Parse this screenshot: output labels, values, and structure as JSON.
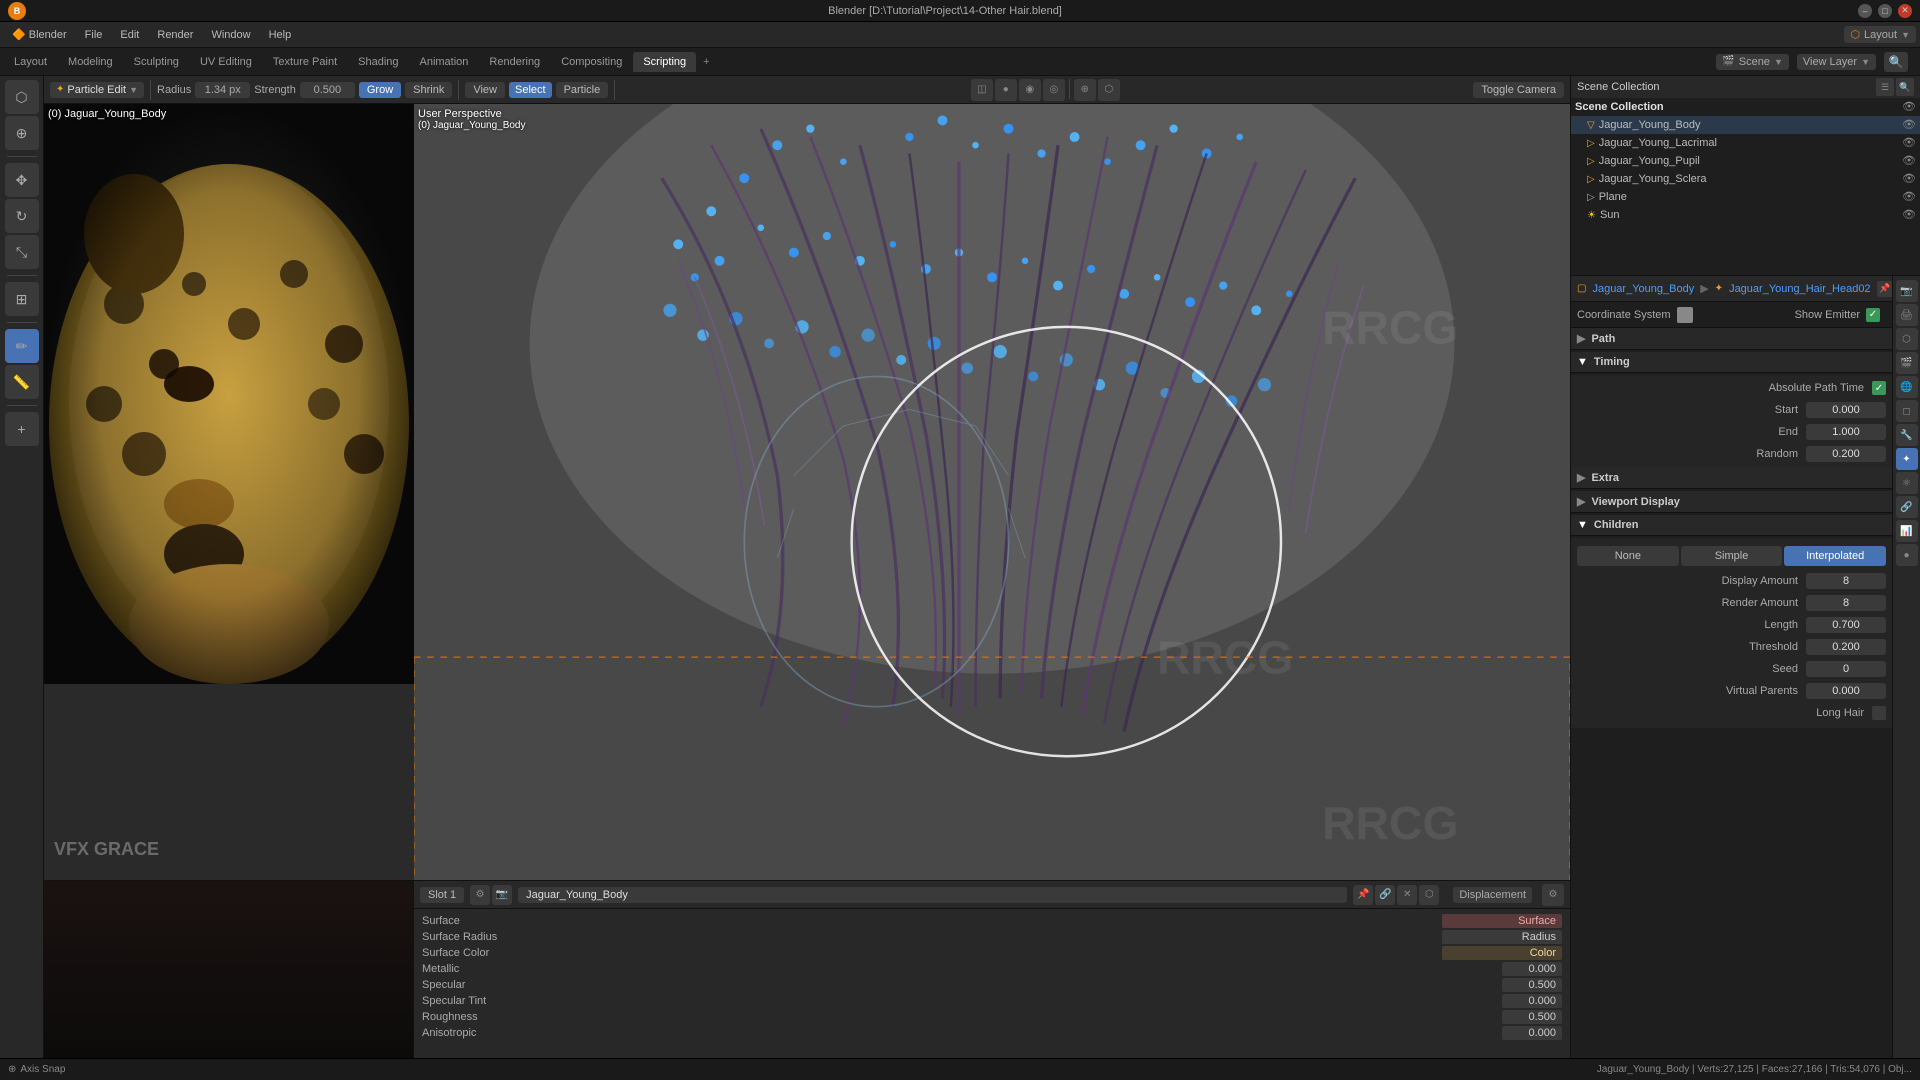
{
  "titlebar": {
    "title": "Blender [D:\\Tutorial\\Project\\14-Other Hair.blend]",
    "minimize": "–",
    "maximize": "□",
    "close": "✕"
  },
  "menubar": {
    "items": [
      "Blender",
      "File",
      "Edit",
      "Render",
      "Window",
      "Help"
    ]
  },
  "layout_label": "Layout",
  "workspace_tabs": [
    {
      "label": "Layout",
      "active": false
    },
    {
      "label": "Modeling",
      "active": false
    },
    {
      "label": "Sculpting",
      "active": false
    },
    {
      "label": "UV Editing",
      "active": false
    },
    {
      "label": "Texture Paint",
      "active": false
    },
    {
      "label": "Shading",
      "active": false
    },
    {
      "label": "Animation",
      "active": false
    },
    {
      "label": "Rendering",
      "active": false
    },
    {
      "label": "Compositing",
      "active": false
    },
    {
      "label": "Scripting",
      "active": true
    }
  ],
  "viewport_toolbar": {
    "mode": "Particle Edit",
    "radius_label": "Radius",
    "radius_value": "1.34 px",
    "strength_label": "Strength",
    "strength_value": "0.500",
    "grow_btn": "Grow",
    "shrink_btn": "Shrink",
    "view_btn": "View",
    "select_btn": "Select",
    "particle_btn": "Particle",
    "toggle_camera": "Toggle Camera"
  },
  "viewport": {
    "info_top": "User Perspective",
    "info_obj": "(0) Jaguar_Young_Body"
  },
  "outliner": {
    "title": "Scene Collection",
    "items": [
      {
        "label": "Scene Collection",
        "level": 0,
        "icon": "▷",
        "type": "collection"
      },
      {
        "label": "Jaguar_Young_Body",
        "level": 1,
        "icon": "▽",
        "type": "object"
      },
      {
        "label": "Jaguar_Young_Lacrimal",
        "level": 1,
        "icon": "▷",
        "type": "object"
      },
      {
        "label": "Jaguar_Young_Pupil",
        "level": 1,
        "icon": "▷",
        "type": "object"
      },
      {
        "label": "Jaguar_Young_Sclera",
        "level": 1,
        "icon": "▷",
        "type": "object"
      },
      {
        "label": "Plane",
        "level": 1,
        "icon": "▷",
        "type": "object"
      },
      {
        "label": "Sun",
        "level": 1,
        "icon": "▷",
        "type": "object"
      }
    ]
  },
  "particle_breadcrumb": {
    "obj": "Jaguar_Young_Body",
    "sep": "▶",
    "system": "Jaguar_Young_Hair_Head02"
  },
  "coord_system": {
    "label": "Coordinate System",
    "icon": "⬛"
  },
  "show_emitter": "Show Emitter",
  "sections": {
    "path": {
      "label": "Path",
      "open": false
    },
    "timing": {
      "label": "Timing",
      "open": true
    },
    "extra": {
      "label": "Extra",
      "open": false
    },
    "viewport_display": {
      "label": "Viewport Display",
      "open": false
    },
    "children": {
      "label": "Children",
      "open": true
    }
  },
  "timing": {
    "absolute_path_time": "Absolute Path Time",
    "start_label": "Start",
    "start_value": "0.000",
    "end_label": "End",
    "end_value": "1.000",
    "random_label": "Random",
    "random_value": "0.200"
  },
  "children": {
    "none_btn": "None",
    "simple_btn": "Simple",
    "interpolated_btn": "Interpolated",
    "display_amount_label": "Display Amount",
    "display_amount_value": "8",
    "render_amount_label": "Render Amount",
    "render_amount_value": "8",
    "length_label": "Length",
    "length_value": "0.700",
    "threshold_label": "Threshold",
    "threshold_value": "0.200",
    "seed_label": "Seed",
    "seed_value": "0",
    "virtual_parents_label": "Virtual Parents",
    "virtual_parents_value": "0.000",
    "long_hair_label": "Long Hair"
  },
  "slot_panel": {
    "slot": "Slot 1",
    "object": "Jaguar_Young_Body",
    "displacement": "Displacement"
  },
  "material_panel": {
    "surface_label": "Surface",
    "surface_radius_label": "Surface Radius",
    "surface_color_label": "Surface Color",
    "metallic_label": "Metallic",
    "metallic_value": "0.000",
    "specular_label": "Specular",
    "specular_value": "0.500",
    "specular_tint_label": "Specular Tint",
    "specular_tint_value": "0.000",
    "roughness_label": "Roughness",
    "roughness_value": "0.500",
    "anisotropic_label": "Anisotropic",
    "anisotropic_value": "0.000"
  },
  "view_layer": "View Layer",
  "scene": "Scene",
  "status_bar": {
    "axis_snap": "Axis Snap",
    "obj_info": "Jaguar_Young_Body | Verts:27,125 | Faces:27,166 | Tris:54,076 | Obj...",
    "rrcg": "RRCG"
  }
}
